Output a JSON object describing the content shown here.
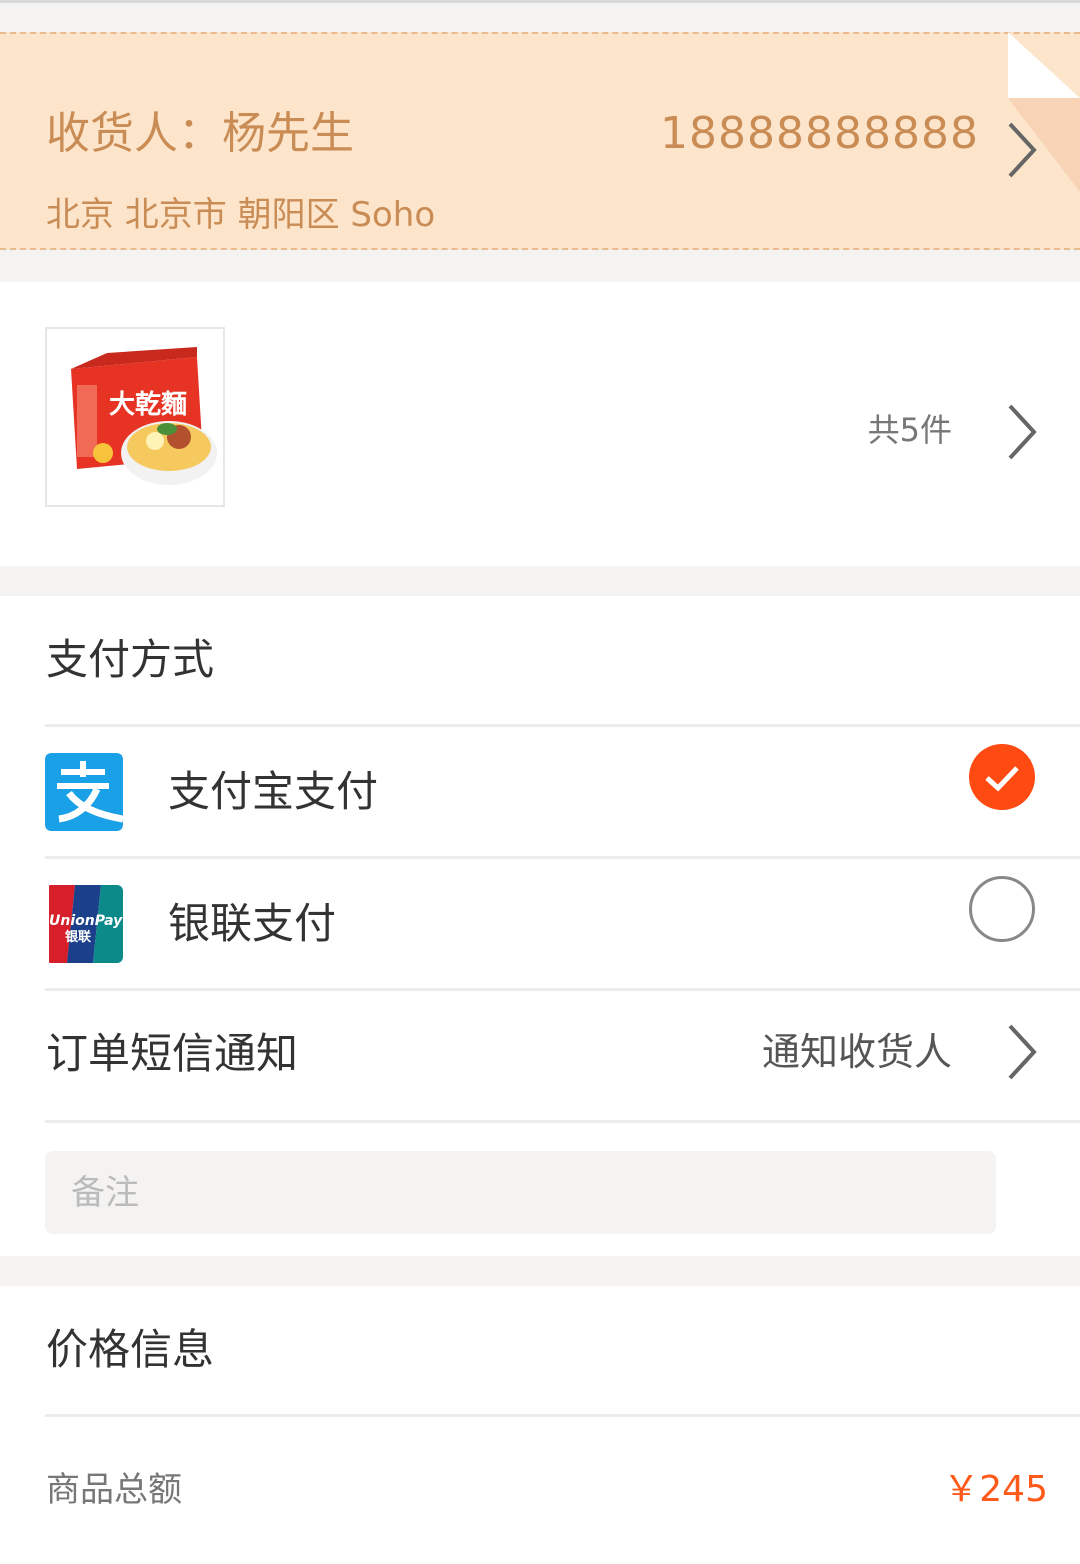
{
  "address": {
    "receiver": "收货人：杨先生",
    "phone": "18888888888",
    "detail": "北京 北京市 朝阳区 Soho"
  },
  "product": {
    "count_text": "共5件",
    "image_label": "大乾麵"
  },
  "payment": {
    "title": "支付方式",
    "options": [
      {
        "label": "支付宝支付",
        "selected": true,
        "icon": "alipay-icon",
        "color": "#1aa0e6"
      },
      {
        "label": "银联支付",
        "selected": false,
        "icon": "unionpay-icon",
        "unionpay_text_1": "UnionPay",
        "unionpay_text_2": "银联"
      }
    ]
  },
  "sms": {
    "label": "订单短信通知",
    "value": "通知收货人"
  },
  "remark": {
    "placeholder": "备注"
  },
  "price": {
    "title": "价格信息",
    "goods_total_label": "商品总额",
    "goods_total_value": "￥245"
  },
  "colors": {
    "accent": "#ff4a12",
    "address_bg": "#fde5cc",
    "address_text": "#c98c55",
    "price": "#ff5a1a"
  }
}
